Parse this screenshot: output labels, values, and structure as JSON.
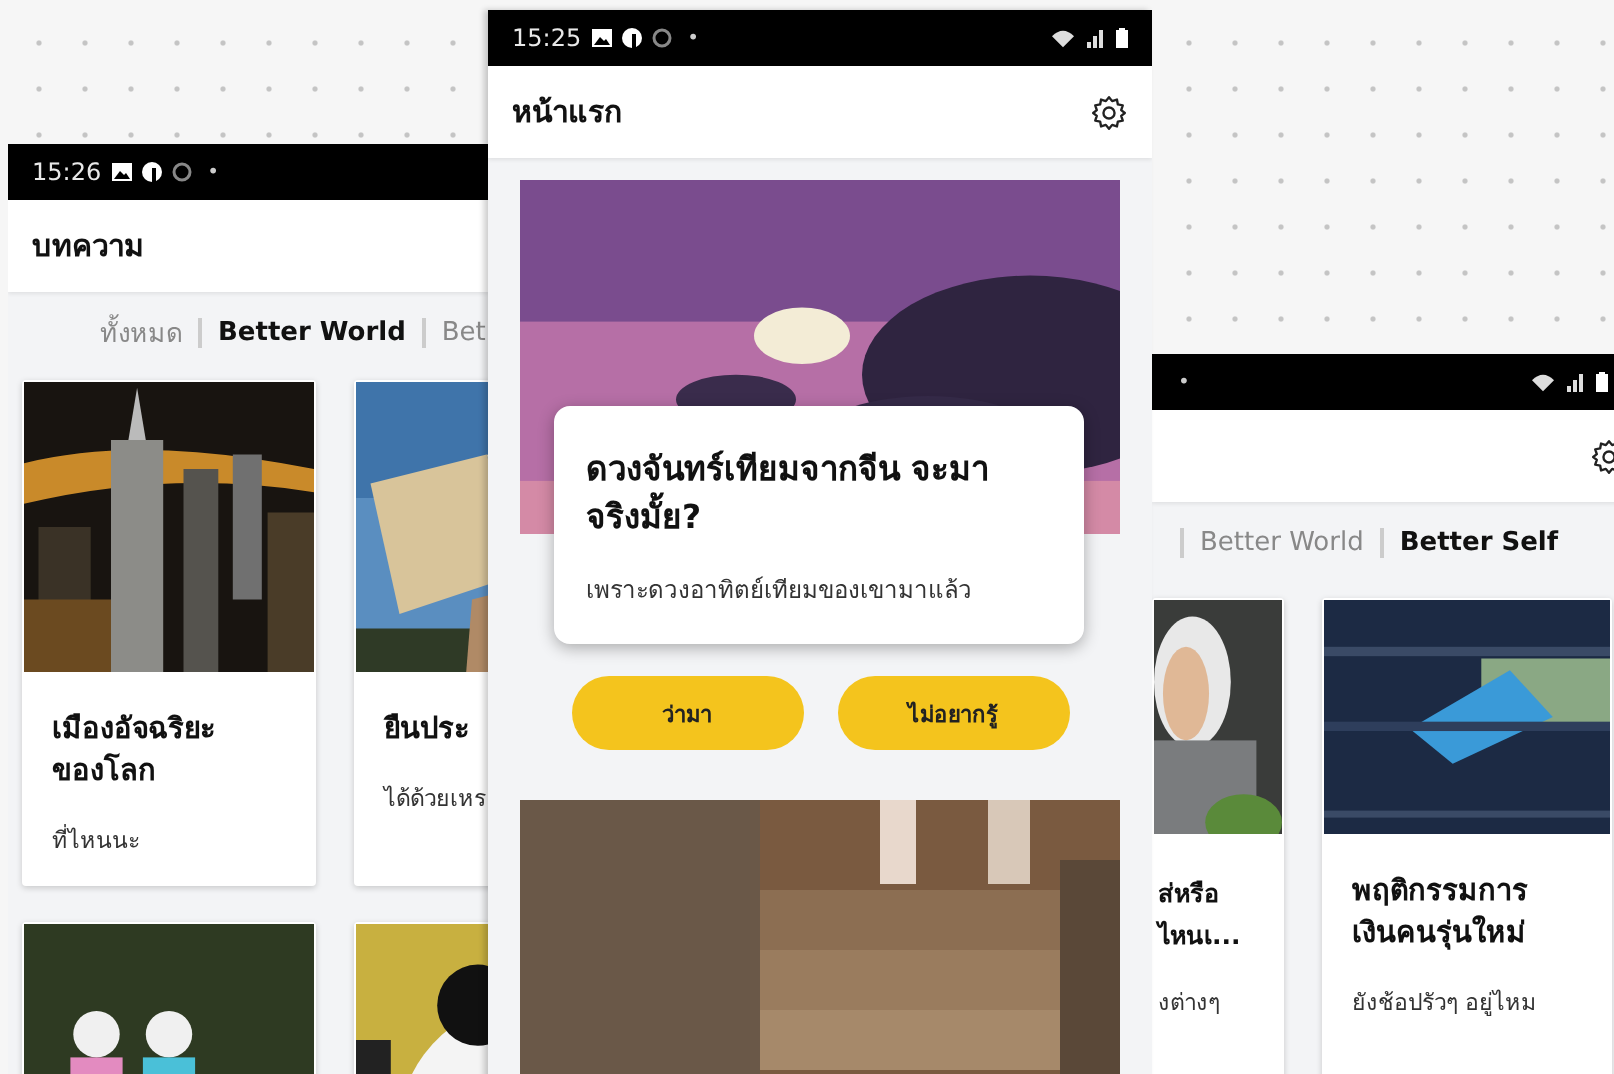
{
  "left_screen": {
    "status_bar": {
      "time": "15:26",
      "dot": "•"
    },
    "title": "บทความ",
    "tabs": [
      {
        "label": "ทั้งหมด",
        "selected": false
      },
      {
        "label": "Better World",
        "selected": true
      },
      {
        "label": "Bet",
        "selected": false
      }
    ],
    "cards": [
      {
        "kind": "article",
        "title": "เมืองอัจฉริยะของโลก",
        "subtitle": "ที่ไหนนะ"
      },
      {
        "kind": "article",
        "title": "ยืนประ",
        "subtitle": "ได้ด้วยเหร"
      },
      {
        "kind": "picture"
      },
      {
        "kind": "picture"
      }
    ]
  },
  "home_screen": {
    "status_bar": {
      "time": "15:25",
      "dot": "•"
    },
    "title": "หน้าแรก",
    "dialog": {
      "title": "ดวงจันทร์เทียมจากจีน จะมาจริงมั้ย?",
      "body": "เพราะดวงอาทิตย์เทียมของเขามาแล้ว"
    },
    "buttons": [
      "ว่ามา",
      "ไม่อยากรู้"
    ]
  },
  "right_screen": {
    "status_bar": {
      "dot": "•"
    },
    "tabs": [
      {
        "label": "Better World",
        "selected": false
      },
      {
        "label": "Better Self",
        "selected": true
      }
    ],
    "cards": [
      {
        "title": "ส่หรือ ไหนเ...",
        "subtitle": "งต่างๆ"
      },
      {
        "title": "พฤติกรรมการเงินคนรุ่นใหม่",
        "subtitle": "ยังช้อปรัวๆ อยู่ไหม"
      }
    ]
  }
}
